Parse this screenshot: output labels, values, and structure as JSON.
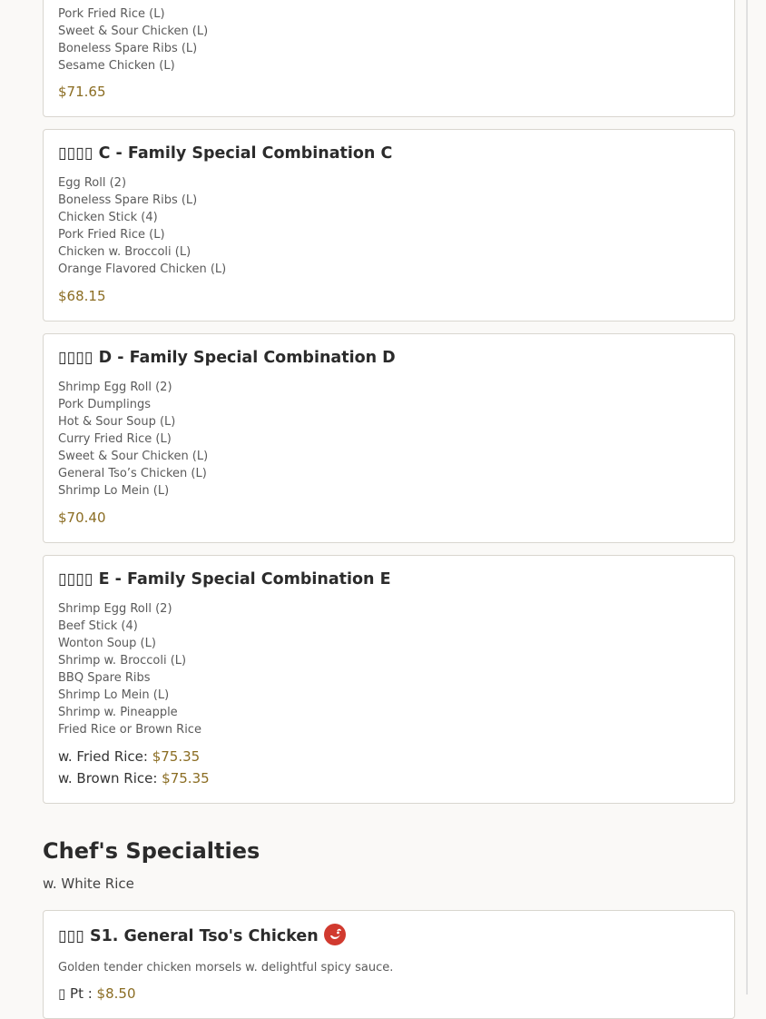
{
  "card_b": {
    "items": [
      "Pork Fried Rice (L)",
      "Sweet & Sour Chicken (L)",
      "Boneless Spare Ribs (L)",
      "Sesame Chicken (L)"
    ],
    "price": "$71.65"
  },
  "card_c": {
    "title": "▯▯▯▯ C - Family Special Combination C",
    "items": [
      "Egg Roll (2)",
      "Boneless Spare Ribs (L)",
      "Chicken Stick (4)",
      "Pork Fried Rice (L)",
      "Chicken w. Broccoli (L)",
      "Orange Flavored Chicken (L)"
    ],
    "price": "$68.15"
  },
  "card_d": {
    "title": "▯▯▯▯ D - Family Special Combination D",
    "items": [
      "Shrimp Egg Roll (2)",
      "Pork Dumplings",
      "Hot & Sour Soup (L)",
      "Curry Fried Rice (L)",
      "Sweet & Sour Chicken (L)",
      "General Tso’s Chicken (L)",
      "Shrimp Lo Mein (L)"
    ],
    "price": "$70.40"
  },
  "card_e": {
    "title": "▯▯▯▯ E - Family Special Combination E",
    "items": [
      "Shrimp Egg Roll (2)",
      "Beef Stick (4)",
      "Wonton Soup (L)",
      "Shrimp w. Broccoli (L)",
      "BBQ Spare Ribs",
      "Shrimp Lo Mein (L)",
      "Shrimp w. Pineapple",
      "Fried Rice or Brown Rice"
    ],
    "fried_label": "w. Fried Rice: ",
    "fried_price": "$75.35",
    "brown_label": "w. Brown Rice: ",
    "brown_price": "$75.35"
  },
  "section": {
    "title": "Chef's Specialties",
    "subtitle": "w. White Rice"
  },
  "card_s1": {
    "title": "▯▯▯ S1. General Tso's Chicken",
    "icon": "spicy-pepper-icon",
    "description": "Golden tender chicken morsels w. delightful spicy sauce.",
    "size_label": "▯ Pt : ",
    "price": "$8.50"
  },
  "colors": {
    "price": "#8b6d23",
    "spicy": "#d13a2f"
  }
}
